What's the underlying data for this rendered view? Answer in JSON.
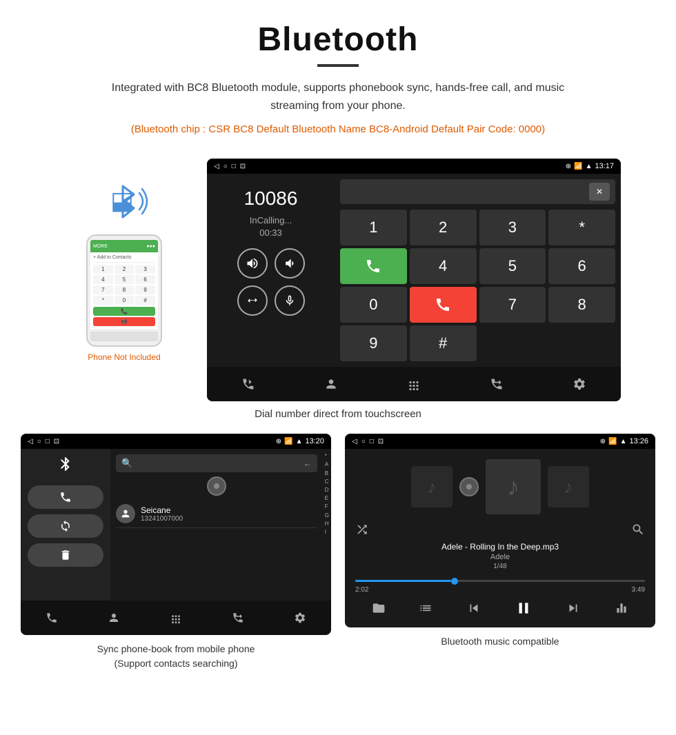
{
  "header": {
    "title": "Bluetooth",
    "description": "Integrated with BC8 Bluetooth module, supports phonebook sync, hands-free call, and music streaming from your phone.",
    "specs": "(Bluetooth chip : CSR BC8    Default Bluetooth Name BC8-Android    Default Pair Code: 0000)"
  },
  "phone_label": "Phone Not Included",
  "dialer": {
    "number": "10086",
    "status": "InCalling...",
    "timer": "00:33",
    "time": "13:17",
    "keys": [
      "1",
      "2",
      "3",
      "*",
      "4",
      "5",
      "6",
      "0",
      "7",
      "8",
      "9",
      "#"
    ]
  },
  "dialer_caption": "Dial number direct from touchscreen",
  "contacts": {
    "time": "13:20",
    "contact_name": "Seicane",
    "contact_number": "13241007000",
    "alphabet": [
      "*",
      "A",
      "B",
      "C",
      "D",
      "E",
      "F",
      "G",
      "H",
      "I"
    ]
  },
  "contacts_caption_line1": "Sync phone-book from mobile phone",
  "contacts_caption_line2": "(Support contacts searching)",
  "music": {
    "time": "13:26",
    "title": "Adele - Rolling In the Deep.mp3",
    "artist": "Adele",
    "count": "1/48",
    "current_time": "2:02",
    "total_time": "3:49"
  },
  "music_caption": "Bluetooth music compatible",
  "nav_icons": {
    "back": "◁",
    "home": "○",
    "recents": "□",
    "screenshot": "⊡"
  }
}
